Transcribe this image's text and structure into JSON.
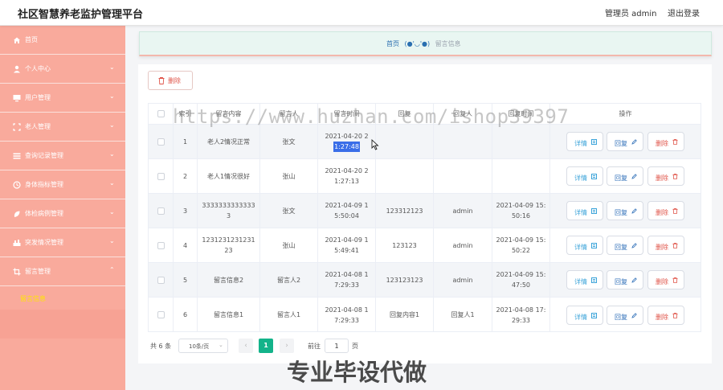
{
  "app": {
    "title": "社区智慧养老监护管理平台",
    "admin_label": "管理员 admin",
    "logout_label": "退出登录"
  },
  "sidebar": {
    "items": [
      {
        "label": "首页",
        "icon": "home-icon",
        "has_arrow": false
      },
      {
        "label": "个人中心",
        "icon": "person-icon",
        "has_arrow": true
      },
      {
        "label": "用户管理",
        "icon": "monitor-icon",
        "has_arrow": true
      },
      {
        "label": "老人管理",
        "icon": "frame-icon",
        "has_arrow": true
      },
      {
        "label": "查询记录管理",
        "icon": "list-icon",
        "has_arrow": true
      },
      {
        "label": "身体指标管理",
        "icon": "clock-icon",
        "has_arrow": true
      },
      {
        "label": "体检病例管理",
        "icon": "leaf-icon",
        "has_arrow": true
      },
      {
        "label": "突发情况管理",
        "icon": "tools-icon",
        "has_arrow": true
      },
      {
        "label": "留言管理",
        "icon": "crop-icon",
        "has_arrow": true,
        "arrow": "up"
      }
    ],
    "sub_item": "留言信息"
  },
  "breadcrumb": {
    "home": "首页",
    "face": "(●'◡'●)",
    "current": "留言信息"
  },
  "toolbar": {
    "delete_label": "删除"
  },
  "table": {
    "headers": [
      "",
      "索引",
      "留言内容",
      "留言人",
      "留言时间",
      "回复",
      "回复人",
      "回复时间",
      "操作"
    ],
    "rows": [
      {
        "index": "1",
        "content": "老人2情况正常",
        "author": "张文",
        "time_a": "2021-04-20 2",
        "time_b": "1:27:48",
        "reply": "",
        "replier": "",
        "reply_time": ""
      },
      {
        "index": "2",
        "content": "老人1情况很好",
        "author": "张山",
        "time_a": "2021-04-20 2",
        "time_b": "1:27:13",
        "reply": "",
        "replier": "",
        "reply_time": ""
      },
      {
        "index": "3",
        "content": "33333333333333",
        "author": "张文",
        "time_a": "2021-04-09 1",
        "time_b": "5:50:04",
        "reply": "123312123",
        "replier": "admin",
        "reply_time": "2021-04-09 15:50:16"
      },
      {
        "index": "4",
        "content": "123123123123123",
        "author": "张山",
        "time_a": "2021-04-09 1",
        "time_b": "5:49:41",
        "reply": "123123",
        "replier": "admin",
        "reply_time": "2021-04-09 15:50:22"
      },
      {
        "index": "5",
        "content": "留言信息2",
        "author": "留言人2",
        "time_a": "2021-04-08 1",
        "time_b": "7:29:33",
        "reply": "123123123",
        "replier": "admin",
        "reply_time": "2021-04-09 15:47:50"
      },
      {
        "index": "6",
        "content": "留言信息1",
        "author": "留言人1",
        "time_a": "2021-04-08 1",
        "time_b": "7:29:33",
        "reply": "回复内容1",
        "replier": "回复人1",
        "reply_time": "2021-04-08 17:29:33"
      }
    ],
    "actions": {
      "view": "详情",
      "reply": "回复",
      "delete": "删除"
    }
  },
  "pagination": {
    "total": "共 6 条",
    "page_size": "10条/页",
    "current_page": "1",
    "goto_label": "前往",
    "goto_value": "1",
    "page_label": "页"
  },
  "watermark": {
    "url": "https://www.huzhan.com/ishop39397",
    "banner": "专业毕设代做"
  },
  "colors": {
    "sidebar": "#f9aa9c",
    "accent_green": "#13b38a",
    "delete_red": "#e0554a",
    "submenu_active": "#ffe600"
  }
}
